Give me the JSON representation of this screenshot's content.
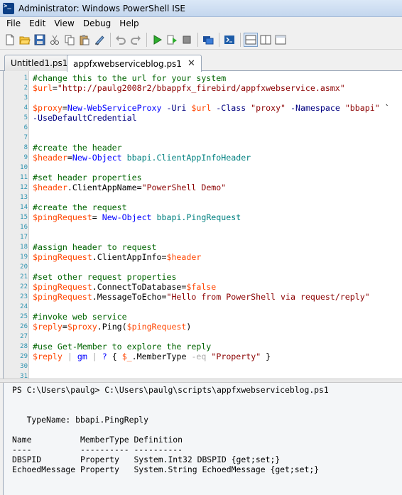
{
  "window": {
    "title": "Administrator: Windows PowerShell ISE"
  },
  "menu": [
    "File",
    "Edit",
    "View",
    "Debug",
    "Help"
  ],
  "toolbar": {
    "buttons": [
      "new-icon",
      "open-icon",
      "save-icon",
      "cut-icon",
      "copy-icon",
      "paste-icon",
      "clear-icon",
      "undo-icon",
      "redo-icon",
      "run-icon",
      "run-selection-icon",
      "stop-icon",
      "remote-tab-icon",
      "powershell-icon",
      "layout-top-icon",
      "layout-right-icon",
      "layout-max-icon"
    ]
  },
  "tabs": [
    {
      "label": "Untitled1.ps1",
      "active": false
    },
    {
      "label": "appfxwebserviceblog.ps1",
      "active": true,
      "close": "✕"
    }
  ],
  "editor": {
    "line_numbers": [
      "1",
      "2",
      "3",
      "4",
      "5",
      "6",
      "7",
      "8",
      "9",
      "10",
      "11",
      "12",
      "13",
      "14",
      "15",
      "16",
      "17",
      "18",
      "19",
      "20",
      "21",
      "22",
      "23",
      "24",
      "25",
      "26",
      "27",
      "28",
      "29",
      "30",
      "31"
    ],
    "lines": [
      [
        {
          "t": "#change this to the url for your system",
          "c": "c-comment"
        }
      ],
      [
        {
          "t": "$url",
          "c": "c-var"
        },
        {
          "t": "=",
          "c": "c-plain"
        },
        {
          "t": "\"http://paulg2008r2/bbappfx_firebird/appfxwebservice.asmx\"",
          "c": "c-str"
        }
      ],
      [],
      [
        {
          "t": "$proxy",
          "c": "c-var"
        },
        {
          "t": "=",
          "c": "c-plain"
        },
        {
          "t": "New-WebServiceProxy",
          "c": "c-cmd"
        },
        {
          "t": " ",
          "c": "c-plain"
        },
        {
          "t": "-Uri",
          "c": "c-param"
        },
        {
          "t": " ",
          "c": "c-plain"
        },
        {
          "t": "$url",
          "c": "c-var"
        },
        {
          "t": " ",
          "c": "c-plain"
        },
        {
          "t": "-Class",
          "c": "c-param"
        },
        {
          "t": " ",
          "c": "c-plain"
        },
        {
          "t": "\"proxy\"",
          "c": "c-str"
        },
        {
          "t": " ",
          "c": "c-plain"
        },
        {
          "t": "-Namespace",
          "c": "c-param"
        },
        {
          "t": " ",
          "c": "c-plain"
        },
        {
          "t": "\"bbapi\"",
          "c": "c-str"
        },
        {
          "t": " `",
          "c": "c-plain"
        }
      ],
      [
        {
          "t": "-UseDefaultCredential",
          "c": "c-param"
        }
      ],
      [],
      [],
      [
        {
          "t": "#create the header",
          "c": "c-comment"
        }
      ],
      [
        {
          "t": "$header",
          "c": "c-var"
        },
        {
          "t": "=",
          "c": "c-plain"
        },
        {
          "t": "New-Object",
          "c": "c-cmd"
        },
        {
          "t": " ",
          "c": "c-plain"
        },
        {
          "t": "bbapi.ClientAppInfoHeader",
          "c": "c-type"
        }
      ],
      [],
      [
        {
          "t": "#set header properties",
          "c": "c-comment"
        }
      ],
      [
        {
          "t": "$header",
          "c": "c-var"
        },
        {
          "t": ".ClientAppName=",
          "c": "c-plain"
        },
        {
          "t": "\"PowerShell Demo\"",
          "c": "c-str"
        }
      ],
      [],
      [
        {
          "t": "#create the request",
          "c": "c-comment"
        }
      ],
      [
        {
          "t": "$pingRequest",
          "c": "c-var"
        },
        {
          "t": "= ",
          "c": "c-plain"
        },
        {
          "t": "New-Object",
          "c": "c-cmd"
        },
        {
          "t": " ",
          "c": "c-plain"
        },
        {
          "t": "bbapi.PingRequest",
          "c": "c-type"
        }
      ],
      [],
      [],
      [
        {
          "t": "#assign header to request",
          "c": "c-comment"
        }
      ],
      [
        {
          "t": "$pingRequest",
          "c": "c-var"
        },
        {
          "t": ".ClientAppInfo=",
          "c": "c-plain"
        },
        {
          "t": "$header",
          "c": "c-var"
        }
      ],
      [],
      [
        {
          "t": "#set other request properties",
          "c": "c-comment"
        }
      ],
      [
        {
          "t": "$pingRequest",
          "c": "c-var"
        },
        {
          "t": ".ConnectToDatabase=",
          "c": "c-plain"
        },
        {
          "t": "$false",
          "c": "c-var"
        }
      ],
      [
        {
          "t": "$pingRequest",
          "c": "c-var"
        },
        {
          "t": ".MessageToEcho=",
          "c": "c-plain"
        },
        {
          "t": "\"Hello from PowerShell via request/reply\"",
          "c": "c-str"
        }
      ],
      [],
      [
        {
          "t": "#invoke web service",
          "c": "c-comment"
        }
      ],
      [
        {
          "t": "$reply",
          "c": "c-var"
        },
        {
          "t": "=",
          "c": "c-plain"
        },
        {
          "t": "$proxy",
          "c": "c-var"
        },
        {
          "t": ".Ping(",
          "c": "c-plain"
        },
        {
          "t": "$pingRequest",
          "c": "c-var"
        },
        {
          "t": ")",
          "c": "c-plain"
        }
      ],
      [],
      [
        {
          "t": "#use Get-Member to explore the reply",
          "c": "c-comment"
        }
      ],
      [
        {
          "t": "$reply",
          "c": "c-var"
        },
        {
          "t": " ",
          "c": "c-plain"
        },
        {
          "t": "|",
          "c": "c-op"
        },
        {
          "t": " ",
          "c": "c-plain"
        },
        {
          "t": "gm",
          "c": "c-cmd"
        },
        {
          "t": " ",
          "c": "c-plain"
        },
        {
          "t": "|",
          "c": "c-op"
        },
        {
          "t": " ",
          "c": "c-plain"
        },
        {
          "t": "?",
          "c": "c-cmd"
        },
        {
          "t": " { ",
          "c": "c-plain"
        },
        {
          "t": "$_",
          "c": "c-var"
        },
        {
          "t": ".MemberType ",
          "c": "c-plain"
        },
        {
          "t": "-eq",
          "c": "c-op"
        },
        {
          "t": " ",
          "c": "c-plain"
        },
        {
          "t": "\"Property\"",
          "c": "c-str"
        },
        {
          "t": " }",
          "c": "c-plain"
        }
      ],
      [],
      []
    ]
  },
  "output": {
    "lines": [
      "PS C:\\Users\\paulg> C:\\Users\\paulg\\scripts\\appfxwebserviceblog.ps1",
      "",
      "",
      "   TypeName: bbapi.PingReply",
      "",
      "Name          MemberType Definition",
      "----          ---------- ----------",
      "DBSPID        Property   System.Int32 DBSPID {get;set;}",
      "EchoedMessage Property   System.String EchoedMessage {get;set;}"
    ]
  }
}
